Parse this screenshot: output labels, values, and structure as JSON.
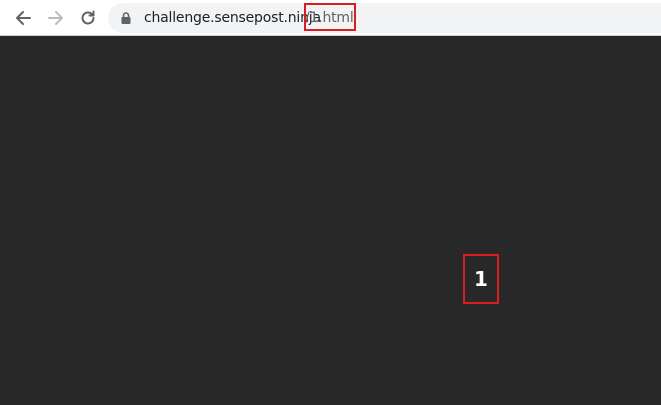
{
  "browser": {
    "url_host": "challenge.sensepost.ninja",
    "url_path": "/1.html",
    "icons": {
      "back": "arrow-left-icon",
      "forward": "arrow-right-icon",
      "reload": "reload-icon",
      "lock": "lock-icon"
    }
  },
  "page": {
    "number": "1",
    "background": "#282828"
  },
  "colors": {
    "highlight": "#d81e1e",
    "text_light": "#ffffff"
  }
}
